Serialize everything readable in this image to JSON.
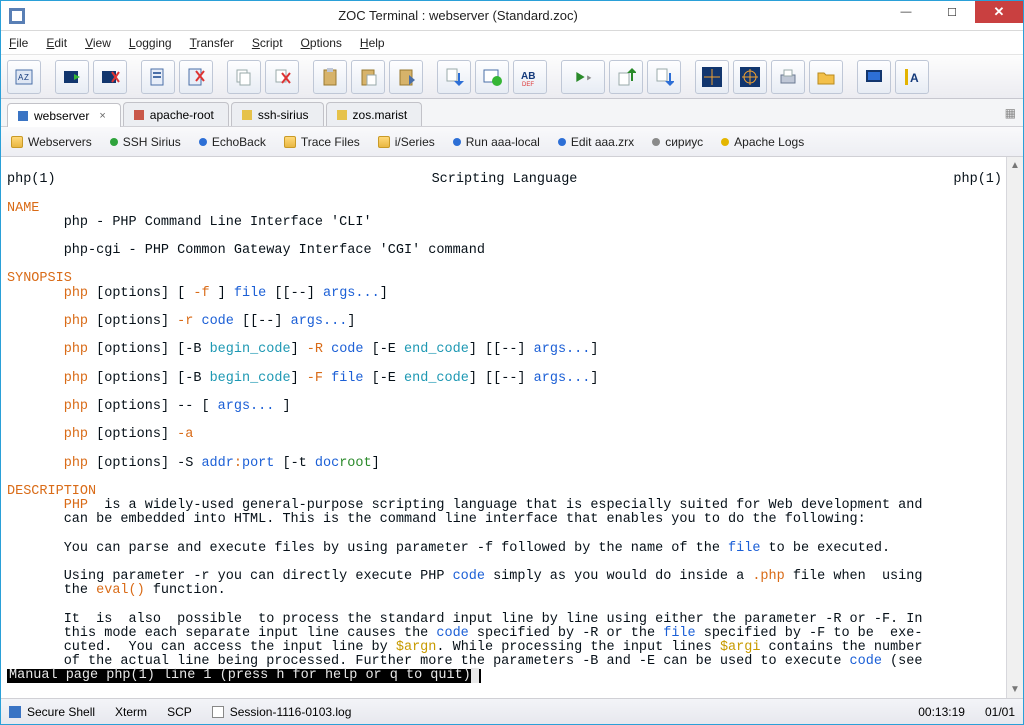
{
  "window": {
    "title": "ZOC Terminal : webserver (Standard.zoc)"
  },
  "menu": {
    "file": "File",
    "edit": "Edit",
    "view": "View",
    "logging": "Logging",
    "transfer": "Transfer",
    "script": "Script",
    "options": "Options",
    "help": "Help"
  },
  "tabs": [
    {
      "label": "webserver",
      "active": true
    },
    {
      "label": "apache-root",
      "active": false
    },
    {
      "label": "ssh-sirius",
      "active": false
    },
    {
      "label": "zos.marist",
      "active": false
    }
  ],
  "quickbar": [
    {
      "icon": "folder",
      "label": "Webservers"
    },
    {
      "icon": "green",
      "label": "SSH Sirius"
    },
    {
      "icon": "blue",
      "label": "EchoBack"
    },
    {
      "icon": "folder",
      "label": "Trace Files"
    },
    {
      "icon": "folder",
      "label": "i/Series"
    },
    {
      "icon": "blue",
      "label": "Run aaa-local"
    },
    {
      "icon": "blue",
      "label": "Edit aaa.zrx"
    },
    {
      "icon": "gray",
      "label": "сириус"
    },
    {
      "icon": "yellow",
      "label": "Apache Logs"
    }
  ],
  "terminal": {
    "header_left": "php(1)",
    "header_center": "Scripting Language",
    "header_right": "php(1)",
    "sections": {
      "name_hdr": "NAME",
      "name_l1": "       php - PHP Command Line Interface 'CLI'",
      "name_l2": "       php-cgi - PHP Common Gateway Interface 'CGI' command",
      "syn_hdr": "SYNOPSIS",
      "desc_hdr": "DESCRIPTION"
    },
    "synopsis": {
      "l1": {
        "a": "php",
        "b": " [options] [ ",
        "c": "-f",
        "d": " ] ",
        "e": "file",
        "f": " [[--] ",
        "g": "args...",
        "h": "]"
      },
      "l2": {
        "a": "php",
        "b": " [options] ",
        "c": "-r",
        "d": " ",
        "e": "code",
        "f": " [[--] ",
        "g": "args...",
        "h": "]"
      },
      "l3": {
        "a": "php",
        "b": " [options] [-B ",
        "c": "begin_code",
        "d": "] ",
        "e": "-R",
        "f": " ",
        "g": "code",
        "h": " [-E ",
        "i": "end_code",
        "j": "] [[--] ",
        "k": "args...",
        "l": "]"
      },
      "l4": {
        "a": "php",
        "b": " [options] [-B ",
        "c": "begin_code",
        "d": "] ",
        "e": "-F",
        "f": " ",
        "g": "file",
        "h": " [-E ",
        "i": "end_code",
        "j": "] [[--] ",
        "k": "args...",
        "l": "]"
      },
      "l5": {
        "a": "php",
        "b": " [options] -- [ ",
        "c": "args...",
        "d": " ]"
      },
      "l6": {
        "a": "php",
        "b": " [options] ",
        "c": "-a"
      },
      "l7": {
        "a": "php",
        "b": " [options] -S ",
        "c": "addr",
        ":": ":",
        "d": "port",
        "e": " [-t ",
        "f": "doc",
        "g": "root",
        "h": "]"
      }
    },
    "desc": {
      "p1a": "PHP",
      "p1b": "  is a widely-used general-purpose scripting language that is especially suited for Web development and",
      "p1c": "       can be embedded into HTML. This is the command line interface that enables you to do the following:",
      "p2a": "       You can parse and execute files by using parameter -f followed by the name of the ",
      "p2b": "file",
      "p2c": " to be executed.",
      "p3a": "       Using parameter -r you can directly execute PHP ",
      "p3b": "code",
      "p3c": " simply as you would do inside a ",
      "p3d": ".php",
      "p3e": " file when  using",
      "p3f": "       the ",
      "p3g": "eval()",
      "p3h": " function.",
      "p4a": "       It  is  also  possible  to process the standard input line by line using either the parameter -R or -F. In",
      "p4b": "       this mode each separate input line causes the ",
      "p4c": "code",
      "p4d": " specified by -R or the ",
      "p4e": "file",
      "p4f": " specified by -F to be  exe‐",
      "p4g": "       cuted.  You can access the input line by ",
      "p4h": "$argn",
      "p4i": ". While processing the input lines ",
      "p4j": "$argi",
      "p4k": " contains the number",
      "p4l": "       of the actual line being processed. Further more the parameters -B and -E can be used to execute ",
      "p4m": "code",
      "p4n": " (see"
    },
    "statusline": "Manual page php(1) line 1 (press h for help or q to quit)"
  },
  "status": {
    "shell": "Secure Shell",
    "emul": "Xterm",
    "proto": "SCP",
    "log": "Session-1116-0103.log",
    "time": "00:13:19",
    "pos": "01/01"
  }
}
